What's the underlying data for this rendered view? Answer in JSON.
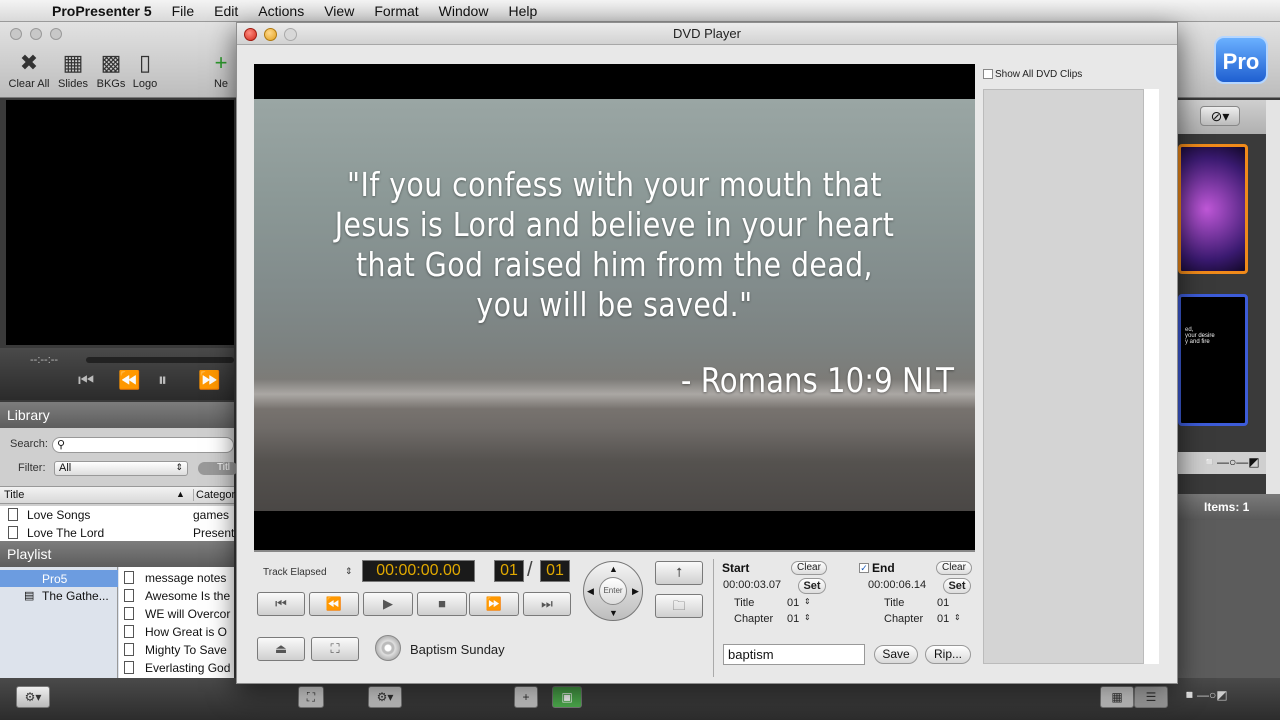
{
  "menubar": {
    "apple": "",
    "app_name": "ProPresenter 5",
    "menus": [
      "File",
      "Edit",
      "Actions",
      "View",
      "Format",
      "Window",
      "Help"
    ]
  },
  "toolbar": {
    "buttons": [
      "Clear All",
      "Slides",
      "BKGs",
      "Logo",
      "Ne"
    ],
    "logo": "Pro"
  },
  "preview": {
    "time": "--:--:--"
  },
  "library": {
    "title": "Library",
    "search_label": "Search:",
    "filter_label": "Filter:",
    "filter_value": "All",
    "pill": "Titl",
    "columns": [
      "Title",
      "Categor"
    ],
    "rows": [
      {
        "title": "Love Songs",
        "category": "games"
      },
      {
        "title": "Love The Lord",
        "category": "Present"
      }
    ]
  },
  "playlist": {
    "title": "Playlist",
    "tree": [
      "Pro5",
      "The Gathe..."
    ],
    "items": [
      "message notes",
      "Awesome Is the",
      "WE will Overcor",
      "How Great is O",
      "Mighty To Save",
      "Everlasting God"
    ]
  },
  "right_panel": {
    "items_label": "Items: 1",
    "thumb_text": "ed,\n your desire\ny and fire"
  },
  "dvd": {
    "window_title": "DVD Player",
    "video": {
      "quote_lines": [
        "\"If you confess with your mouth that",
        "Jesus is Lord and believe in your heart",
        "that God raised him from the dead,",
        "you will be saved.\""
      ],
      "reference": "- Romans 10:9 NLT"
    },
    "track_mode": "Track Elapsed",
    "time": "00:00:00.00",
    "title_num": "01",
    "slash": "/",
    "chapter_num": "01",
    "enter": "Enter",
    "disc_name": "Baptism Sunday",
    "start": {
      "label": "Start",
      "clear": "Clear",
      "time": "00:00:03.07",
      "set": "Set",
      "title_label": "Title",
      "title_value": "01",
      "chapter_label": "Chapter",
      "chapter_value": "01"
    },
    "end": {
      "label": "End",
      "checked": true,
      "clear": "Clear",
      "time": "00:00:06.14",
      "set": "Set",
      "title_label": "Title",
      "title_value": "01",
      "chapter_label": "Chapter",
      "chapter_value": "01"
    },
    "clip_name": "baptism",
    "save": "Save",
    "rip": "Rip...",
    "show_all_clips": "Show All DVD Clips"
  }
}
